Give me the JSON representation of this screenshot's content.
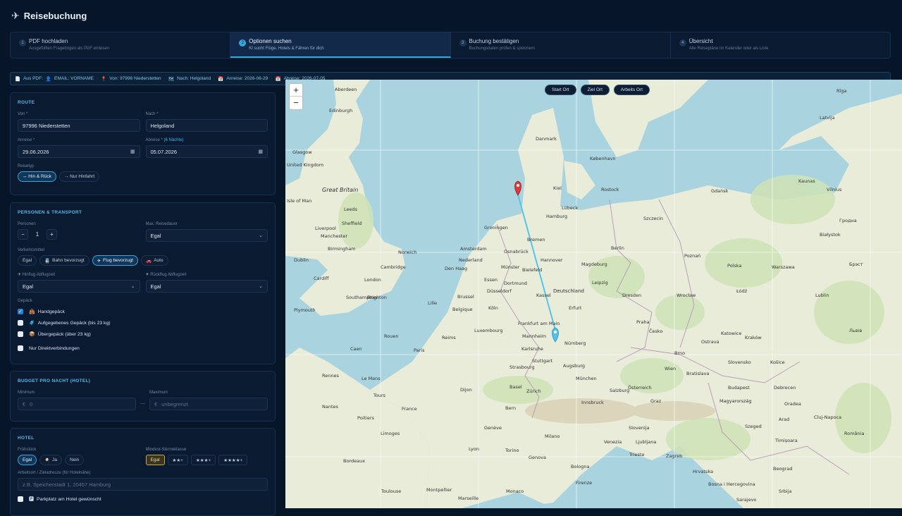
{
  "header": {
    "title": "Reisebuchung"
  },
  "steps": [
    {
      "num": "1",
      "title": "PDF hochladen",
      "sub": "Ausgefüllten Fragebogen als PDF einlesen"
    },
    {
      "num": "2",
      "title": "Optionen suchen",
      "sub": "KI sucht Flüge, Hotels & Fähren für dich"
    },
    {
      "num": "3",
      "title": "Buchung bestätigen",
      "sub": "Buchungsdaten prüfen & speichern"
    },
    {
      "num": "4",
      "title": "Übersicht",
      "sub": "Alle Reisepläne im Kalender oder als Liste"
    }
  ],
  "infobar": {
    "source": "Aus PDF:",
    "email": "EMAIL: VORNAME",
    "from": "Von: 97996 Niederstetten",
    "to": "Nach: Helgoland",
    "arrival": "Anreise: 2026-06-29",
    "departure": "Abreise: 2026-07-05"
  },
  "route": {
    "title": "ROUTE",
    "from_label": "Von *",
    "from_value": "97996 Niederstetten",
    "to_label": "Nach *",
    "to_value": "Helgoland",
    "arrival_label": "Anreise *",
    "arrival_value": "29.06.2026",
    "departure_label": "Abreise *",
    "nights": "(6 Nächte)",
    "departure_value": "05.07.2026",
    "triptype_label": "Reisetyp",
    "roundtrip": "↔ Hin & Rück",
    "oneway": "→ Nur Hinfahrt"
  },
  "persons": {
    "title": "PERSONEN & TRANSPORT",
    "persons_label": "Personen",
    "persons_value": "1",
    "minus": "−",
    "plus": "+",
    "maxdur_label": "Max. Reisedauer",
    "maxdur_value": "Egal",
    "transport_label": "Verkehrsmittel",
    "transport": [
      "Egal",
      "Bahn bevorzugt",
      "Flug bevorzugt",
      "Auto"
    ],
    "outbound_label": "Hinflug Abflugzeit",
    "outbound_value": "Egal",
    "return_label": "Rückflug Abflugzeit",
    "return_value": "Egal",
    "luggage_label": "Gepäck",
    "luggage": [
      "Handgepäck",
      "Aufgegebenes Gepäck (bis 23 kg)",
      "Übergepäck (über 23 kg)"
    ],
    "direct": "Nur Direktverbindungen"
  },
  "budget": {
    "title": "BUDGET PRO NACHT (HOTEL)",
    "min_label": "Minimum",
    "min_currency": "€",
    "min_placeholder": "0",
    "dash": "—",
    "max_label": "Maximum",
    "max_currency": "€",
    "max_placeholder": "unbegrenzt"
  },
  "hotel": {
    "title": "HOTEL",
    "breakfast_label": "Frühstück",
    "breakfast": [
      "Egal",
      "Ja",
      "Nein"
    ],
    "stars_label": "Mindest-Sterneklasse",
    "stars": [
      "Egal",
      "★★+",
      "★★★+",
      "★★★★+"
    ],
    "workplace_label": "Arbeitsort / Zieladresze (für Hotelnähe)",
    "workplace_placeholder": "z.B. Speicherstadt 1, 20457 Hamburg",
    "parking": "Parkplatz am Hotel gewünscht"
  },
  "map": {
    "zoom_in": "+",
    "zoom_out": "−",
    "buttons": [
      "Start Ort",
      "Ziel Ort",
      "Arbeits Ort"
    ],
    "labels": {
      "great_britain": "Great Britain",
      "danmark": "Danmark",
      "hamburg": "Hamburg",
      "bremen": "Bremen",
      "hannover": "Hannover",
      "berlin": "Berlin",
      "nederland": "Nederland",
      "deutschland": "Deutschland",
      "leipzig": "Leipzig",
      "frankfurt": "Frankfurt am Main",
      "nurnberg": "Nürnberg",
      "munchen": "München",
      "paris": "Paris",
      "france": "France",
      "wien": "Wien",
      "budapest": "Budapest",
      "praha": "Praha",
      "kobenhavn": "København",
      "liverpool": "Liverpool",
      "birmingham": "Birmingham",
      "london": "London",
      "glasgow": "Glasgow",
      "dusseldorf": "Düsseldorf",
      "bratislava": "Bratislava",
      "zurich": "Zürich",
      "osterreich": "Österreich",
      "magyarorszag": "Magyarország",
      "genova": "Genova",
      "bologna": "Bologna",
      "milano": "Milano",
      "bordeaux": "Bordeaux",
      "toulouse": "Toulouse",
      "slovenija": "Slovenija",
      "romania": "România",
      "groningen": "Groningen",
      "amsterdam": "Amsterdam",
      "leeds": "Leeds",
      "manchester": "Manchester",
      "sheffield": "Sheffield",
      "cardiff": "Cardiff",
      "brighton": "Brighton",
      "lubeck": "Lübeck",
      "lyon": "Lyon",
      "nantes": "Nantes",
      "le_mans": "Le Mans",
      "augsburg": "Augsburg",
      "strasbourg": "Strasbourg",
      "luxembourg": "Luxembourg",
      "belgique": "Belgique",
      "brussel": "Brussel",
      "lille": "Lille",
      "den_haag": "Den Haag",
      "norwich": "Norwich",
      "plymouth": "Plymouth",
      "southampton": "Southampton",
      "cambridge": "Cambridge",
      "dublin": "Dublin",
      "isle_of_man": "Isle of Man",
      "united_kingdom": "United Kingdom",
      "edinburgh": "Edinburgh",
      "aberdeen": "Aberdeen",
      "ceska": "Česko",
      "polska": "Polska",
      "wroclaw": "Wrocław",
      "poznan": "Poznań",
      "szczecin": "Szczecin",
      "gdansk": "Gdańsk",
      "vilnius": "Vilnius",
      "latvija": "Latvija",
      "zagreb": "Zagreb",
      "beograd": "Beograd",
      "cluj": "Cluj-Napoca",
      "timisoara": "Timișoara",
      "debrecen": "Debrecen",
      "szeged": "Szeged",
      "graz": "Graz",
      "salzburg": "Salzburg",
      "innsbruck": "Innsbruck",
      "bern": "Bern",
      "geneve": "Genève",
      "torino": "Torino",
      "venezia": "Venezia",
      "firenze": "Firenze",
      "ljubljana": "Ljubljana",
      "trieste": "Trieste",
      "monaco": "Monaco",
      "marseille": "Marseille",
      "montpellier": "Montpellier",
      "limoges": "Limoges",
      "poitiers": "Poitiers",
      "tours": "Tours",
      "rennes": "Rennes",
      "caen": "Caen",
      "rouen": "Rouen",
      "reims": "Reims",
      "dijon": "Dijon",
      "basel": "Basel",
      "stuttgart": "Stuttgart",
      "karlsruhe": "Karlsruhe",
      "mannheim": "Mannheim",
      "koln": "Köln",
      "dortmund": "Dortmund",
      "essen": "Essen",
      "munster": "Münster",
      "bielefeld": "Bielefeld",
      "kassel": "Kassel",
      "erfurt": "Erfurt",
      "dresden": "Dresden",
      "magdeburg": "Magdeburg",
      "rostock": "Rostock",
      "kiel": "Kiel",
      "osnabruck": "Osnabrück",
      "lodz": "Łódź",
      "krakow": "Kraków",
      "katowice": "Katowice",
      "ostrava": "Ostrava",
      "brno": "Brno",
      "kosice": "Košice",
      "slovensko": "Slovensko",
      "hrvatska": "Hrvatska",
      "srbija": "Srbija",
      "bosna": "Bosna i Hercegovina",
      "sarajevo": "Sarajevo",
      "arad": "Arad",
      "oradea": "Oradea",
      "lviv": "Львів",
      "warszawa": "Warszawa",
      "lublin": "Lublin",
      "bialystok": "Białystok",
      "kaunas": "Kaunas",
      "grodno": "Гродна",
      "brest": "Брэст",
      "riga": "Rīga"
    }
  }
}
